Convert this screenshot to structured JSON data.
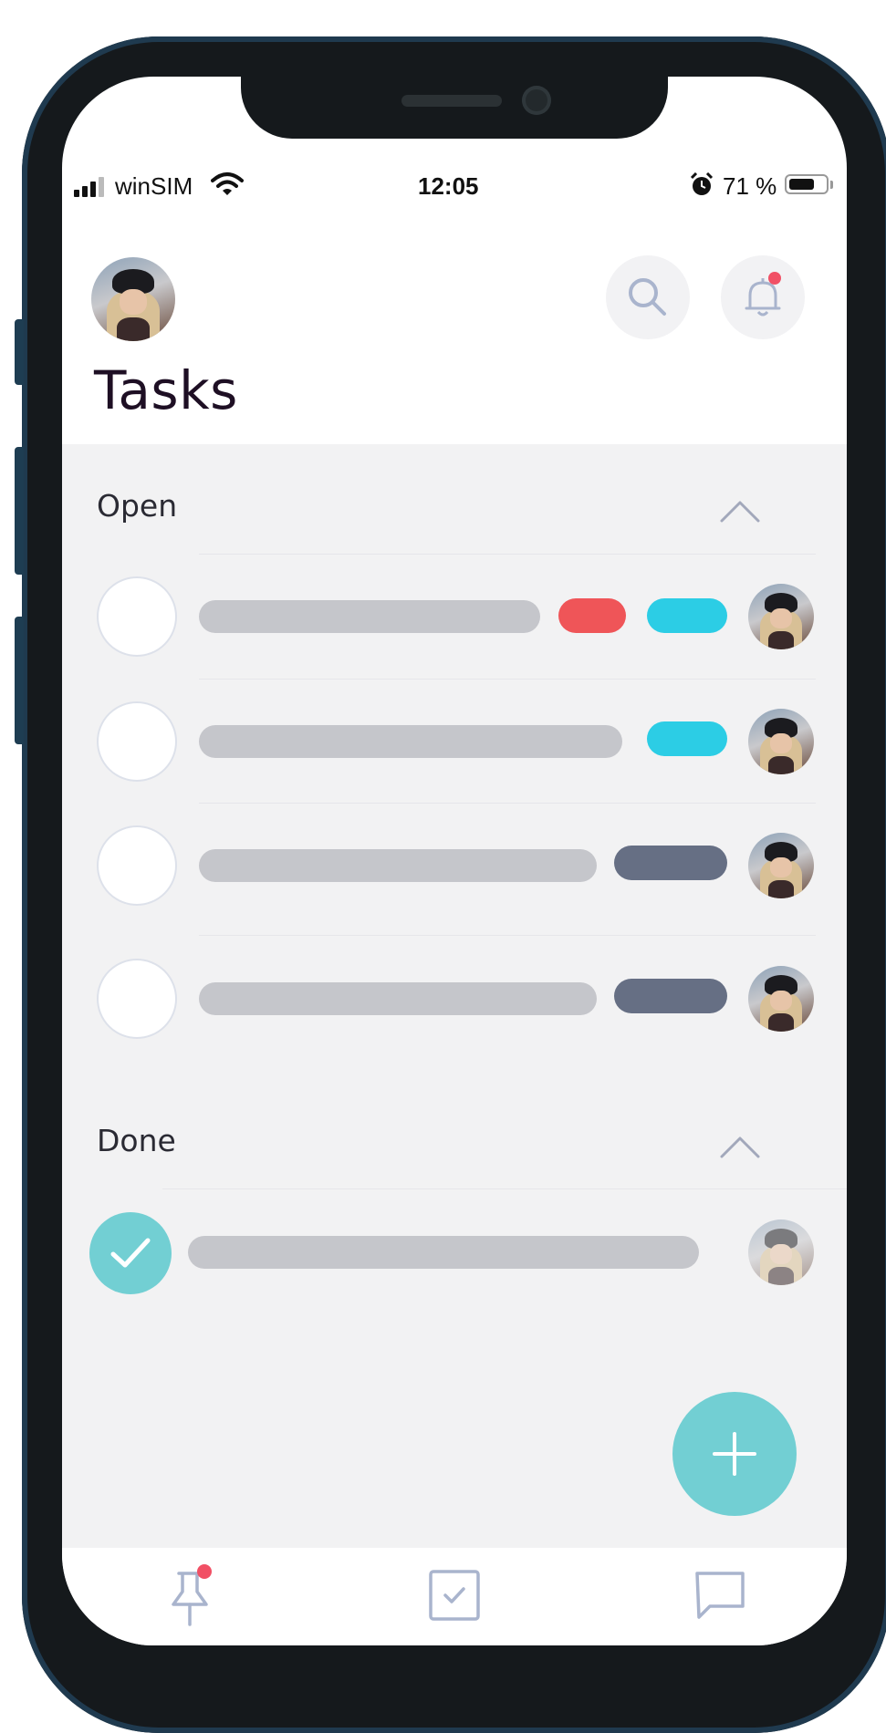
{
  "status_bar": {
    "carrier": "winSIM",
    "time": "12:05",
    "battery_percent_label": "71 %",
    "battery_level": 0.71,
    "icons": [
      "signal-icon",
      "wifi-icon",
      "alarm-icon",
      "battery-icon"
    ]
  },
  "header": {
    "title": "Tasks",
    "icons": [
      "profile-avatar",
      "search-icon",
      "bell-icon"
    ],
    "has_notification": true
  },
  "sections": {
    "open": {
      "title": "Open",
      "tasks": [
        {
          "tags": [
            "red",
            "cyan"
          ]
        },
        {
          "tags": [
            "cyan"
          ]
        },
        {
          "tags": [
            "slate"
          ]
        },
        {
          "tags": [
            "slate"
          ]
        }
      ]
    },
    "done": {
      "title": "Done",
      "tasks": [
        {
          "completed": true
        }
      ]
    }
  },
  "colors": {
    "accent": "#72cfd3",
    "tag_red": "#ef5558",
    "tag_cyan": "#2ccde5",
    "tag_slate": "#666f84",
    "notification": "#f15065",
    "placeholder_bar": "#c5c6cb",
    "background": "#f2f2f3"
  },
  "fab": {
    "icon": "plus-icon"
  },
  "tab_bar": {
    "items": [
      {
        "icon": "pin-icon",
        "has_badge": true
      },
      {
        "icon": "checkbox-icon",
        "has_badge": false
      },
      {
        "icon": "chat-icon",
        "has_badge": false
      }
    ]
  }
}
